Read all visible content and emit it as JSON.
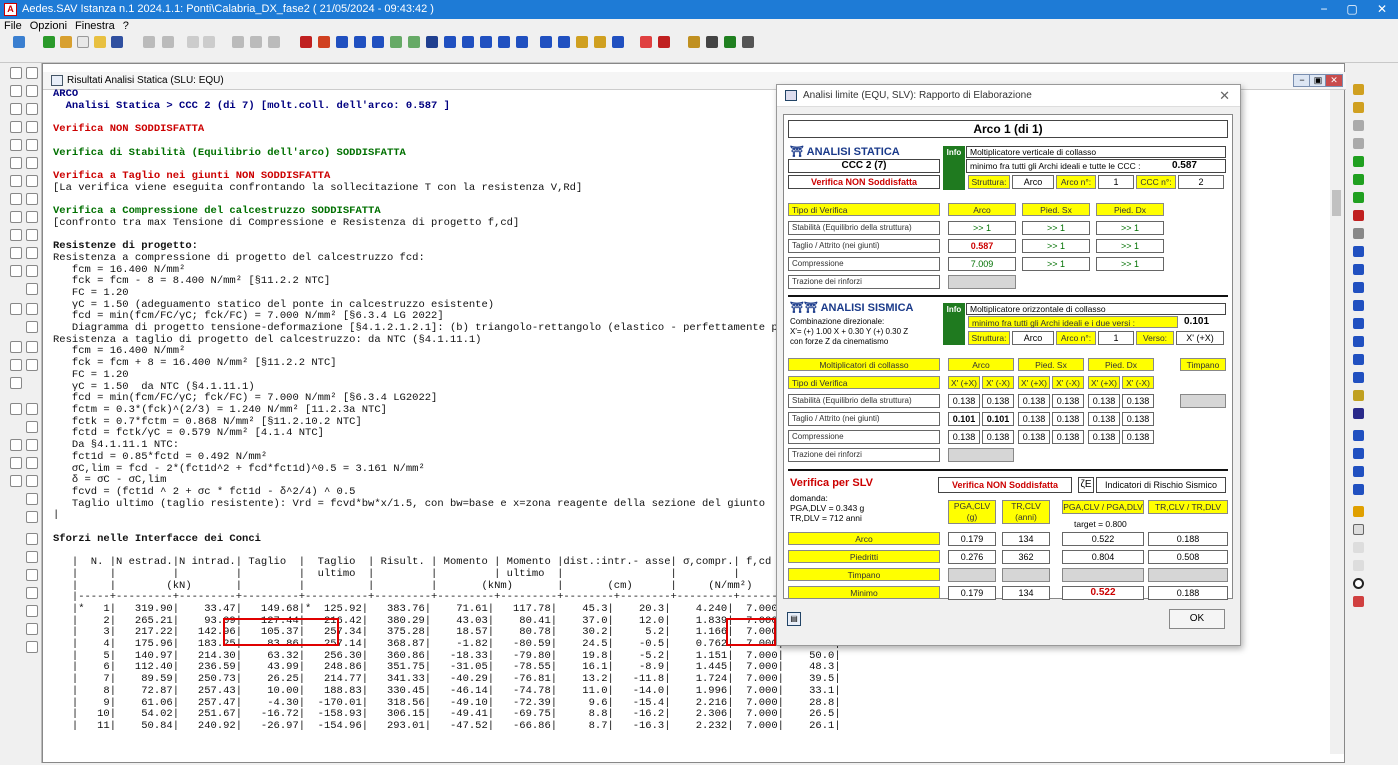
{
  "app": {
    "title": "Aedes.SAV Istanza n.1 2024.1.1: Ponti\\Calabria_DX_fase2  ( 21/05/2024 - 09:43:42 )",
    "minimize": "−",
    "maximize": "▢",
    "close": "✕"
  },
  "menu": [
    "File",
    "Opzioni",
    "Finestra",
    "?"
  ],
  "child": {
    "title": "Risultati Analisi Statica (SLU: EQU)",
    "minimize": "−",
    "restore": "▣",
    "close": "✕"
  },
  "report": {
    "l01": "ARCO",
    "l02": "  Analisi Statica > CCC 2 (di 7) [molt.coll. dell'arco: 0.587 ]",
    "l04": "Verifica NON SODDISFATTA",
    "l06": "Verifica di Stabilità (Equilibrio dell'arco) SODDISFATTA",
    "l08": "Verifica a Taglio nei giunti NON SODDISFATTA",
    "l09": "[La verifica viene eseguita confrontando la sollecitazione T con la resistenza V,Rd]",
    "l11": "Verifica a Compressione del calcestruzzo SODDISFATTA",
    "l12": "[confronto tra max Tensione di Compressione e Resistenza di progetto f,cd]",
    "l14": "Resistenze di progetto:",
    "l15": "Resistenza a compressione di progetto del calcestruzzo fcd:",
    "l16": "   fcm = 16.400 N/mm²",
    "l17": "   fck = fcm - 8 = 8.400 N/mm² [§11.2.2 NTC]",
    "l18": "   FC = 1.20",
    "l19": "   γC = 1.50 (adeguamento statico del ponte in calcestruzzo esistente)",
    "l20": "   fcd = min(fcm/FC/γC; fck/FC) = 7.000 N/mm² [§6.3.4 LG 2022]",
    "l21": "   Diagramma di progetto tensione-deformazione [§4.1.2.1.2.1]: (b) triangolo-rettangolo (elastico - perfettamente plastico)",
    "l22": "Resistenza a taglio di progetto del calcestruzzo: da NTC (§4.1.11.1)",
    "l23": "   fcm = 16.400 N/mm²",
    "l24": "   fck = fcm + 8 = 16.400 N/mm² [§11.2.2 NTC]",
    "l25": "   FC = 1.20",
    "l26": "   γC = 1.50  da NTC (§4.1.11.1)",
    "l27": "   fcd = min(fcm/FC/γC; fck/FC) = 7.000 N/mm² [§6.3.4 LG2022]",
    "l28": "   fctm = 0.3*(fck)^(2/3) = 1.240 N/mm² [11.2.3a NTC]",
    "l29": "   fctk = 0.7*fctm = 0.868 N/mm² [§11.2.10.2 NTC]",
    "l30": "   fctd = fctk/γC = 0.579 N/mm² [4.1.4 NTC]",
    "l31": "   Da §4.1.11.1 NTC:",
    "l32": "   fct1d = 0.85*fctd = 0.492 N/mm²",
    "l33": "   σC,lim = fcd - 2*(fct1d^2 + fcd*fct1d)^0.5 = 3.161 N/mm²",
    "l34": "   δ = σC - σC,lim",
    "l35": "   fcvd = (fct1d ^ 2 + σc * fct1d - δ^2/4) ^ 0.5",
    "l36": "   Taglio ultimo (taglio resistente): Vrd = fcvd*bw*x/1.5, con bw=base e x=zona reagente della sezione del giunto",
    "l39": "Sforzi nelle Interfacce dei Conci",
    "l41": "   |  N. |N estrad.|N intrad.| Taglio  |  Taglio  | Risult. | Momento | Momento |dist.:intr.- asse| σ,compr.| f,cd  |  zona   |",
    "l42": "   |     |         |         |         |  ultimo  |         |         | ultimo  |                 |         |       |reagente|",
    "l43": "   |     |        (kN)       |         |          |         |       (kNm)       |       (cm)      |     (N/mm²)     |  (cm)  |",
    "l44": "   |-----+---------+---------+---------+----------+---------+---------+---------+--------+--------+---------+-------+--------|",
    "rows": [
      "   |*   1|   319.90|    33.47|   149.68|*  125.92|   383.76|    71.61|   117.78|    45.3|    20.3|    4.240|  7.000|    16.7|",
      "   |    2|   265.21|    93.09|   127.44|   216.42|   380.29|    43.03|    80.41|    37.0|    12.0|    1.839|  7.000|    39.0|",
      "   |    3|   217.22|   142.96|   105.37|   257.34|   375.28|    18.57|    80.78|    30.2|     5.2|    1.166|  7.000|    50.0|",
      "   |    4|   175.96|   183.25|    83.86|   257.14|   368.87|    -1.82|   -80.59|    24.5|    -0.5|    0.762|  7.000|    50.0|",
      "   |    5|   140.97|   214.30|    63.32|   256.30|   360.86|   -18.33|   -79.80|    19.8|    -5.2|    1.151|  7.000|    50.0|",
      "   |    6|   112.40|   236.59|    43.99|   248.86|   351.75|   -31.05|   -78.55|    16.1|    -8.9|    1.445|  7.000|    48.3|",
      "   |    7|    89.59|   250.73|    26.25|   214.77|   341.33|   -40.29|   -76.81|    13.2|   -11.8|    1.724|  7.000|    39.5|",
      "   |    8|    72.87|   257.43|    10.00|   188.83|   330.45|   -46.14|   -74.78|    11.0|   -14.0|    1.996|  7.000|    33.1|",
      "   |    9|    61.06|   257.47|    -4.30|  -170.01|   318.56|   -49.10|   -72.39|     9.6|   -15.4|    2.216|  7.000|    28.8|",
      "   |   10|    54.02|   251.67|   -16.72|  -158.93|   306.15|   -49.41|   -69.75|     8.8|   -16.2|    2.306|  7.000|    26.5|",
      "   |   11|    50.84|   240.92|   -26.97|  -154.96|   293.01|   -47.52|   -66.86|     8.7|   -16.3|    2.232|  7.000|    26.1|"
    ]
  },
  "dialog": {
    "title": "Analisi limite (EQU, SLV): Rapporto di Elaborazione",
    "close": "✕",
    "arco_title": "Arco 1 (di 1)",
    "statica": {
      "heading": "ANALISI STATICA",
      "info": "Info",
      "mult_label": "Moltiplicatore verticale di collasso",
      "ccc": "CCC 2 (7)",
      "min_label": "minimo fra tutti gli Archi ideali e tutte le CCC :",
      "min_value": "0.587",
      "verdict": "Verifica NON Soddisfatta",
      "struttura_label": "Struttura:",
      "struttura_value": "Arco",
      "arco_n_label": "Arco n°:",
      "arco_n_value": "1",
      "ccc_n_label": "CCC n°:",
      "ccc_n_value": "2",
      "cols": [
        "Tipo di Verifica",
        "Arco",
        "Pied. Sx",
        "Pied. Dx"
      ],
      "rows": [
        {
          "label": "Stabilità (Equilibrio della struttura)",
          "v": [
            ">> 1",
            ">> 1",
            ">> 1"
          ]
        },
        {
          "label": "Taglio / Attrito (nei giunti)",
          "v": [
            "0.587",
            ">> 1",
            ">> 1"
          ]
        },
        {
          "label": "Compressione",
          "v": [
            "7.009",
            ">> 1",
            ">> 1"
          ]
        },
        {
          "label": "Trazione dei rinforzi",
          "v": []
        }
      ]
    },
    "sismica": {
      "heading": "ANALISI SISMICA",
      "info": "Info",
      "comb_1": "Combinazione direzionale:",
      "comb_2": "X'= (+) 1.00 X + 0.30 Y (+) 0.30 Z",
      "comb_3": "con forze Z da cinematismo",
      "mult_label": "Moltiplicatore orizzontale di collasso",
      "min_label": "minimo fra tutti gli Archi ideali e i due versi :",
      "min_value": "0.101",
      "struttura_label": "Struttura:",
      "struttura_value": "Arco",
      "arco_n_label": "Arco n°:",
      "arco_n_value": "1",
      "verso_label": "Verso:",
      "verso_value": "X' (+X)",
      "cols": [
        "Moltiplicatori di collasso",
        "Arco",
        "Pied. Sx",
        "Pied. Dx",
        "Timpano"
      ],
      "dir_label": "Tipo di Verifica",
      "dirs": [
        "X' (+X)",
        "X' (-X)",
        "X' (+X)",
        "X' (-X)",
        "X' (+X)",
        "X' (-X)"
      ],
      "rows": [
        {
          "label": "Stabilità (Equilibrio della struttura)",
          "v": [
            "0.138",
            "0.138",
            "0.138",
            "0.138",
            "0.138",
            "0.138"
          ]
        },
        {
          "label": "Taglio / Attrito (nei giunti)",
          "v": [
            "0.101",
            "0.101",
            "0.138",
            "0.138",
            "0.138",
            "0.138"
          ]
        },
        {
          "label": "Compressione",
          "v": [
            "0.138",
            "0.138",
            "0.138",
            "0.138",
            "0.138",
            "0.138"
          ]
        },
        {
          "label": "Trazione dei rinforzi",
          "v": []
        }
      ]
    },
    "slv": {
      "heading": "Verifica per SLV",
      "verdict": "Verifica NON Soddisfatta",
      "zeta": "ζE",
      "indicators": "Indicatori di Rischio Sismico",
      "domanda": "domanda:",
      "pga_dlv": "PGA,DLV = 0.343 g",
      "tr_dlv": "TR,DLV = 712 anni",
      "cols": [
        "PGA,CLV\n(g)",
        "TR,CLV\n(anni)",
        "PGA,CLV / PGA,DLV",
        "TR,CLV / TR,DLV"
      ],
      "target": "target = 0.800",
      "rows": [
        {
          "label": "Arco",
          "v": [
            "0.179",
            "134",
            "0.522",
            "0.188"
          ]
        },
        {
          "label": "Piedritti",
          "v": [
            "0.276",
            "362",
            "0.804",
            "0.508"
          ]
        },
        {
          "label": "Timpano",
          "v": [
            "",
            "",
            "",
            ""
          ]
        },
        {
          "label": "Minimo",
          "v": [
            "0.179",
            "134",
            "0.522",
            "0.188"
          ]
        }
      ]
    },
    "ok": "OK"
  },
  "colors": {
    "titlebar": "#1e7bd6",
    "red": "#cc0000",
    "green": "#007000",
    "yellow": "#ffff00"
  }
}
